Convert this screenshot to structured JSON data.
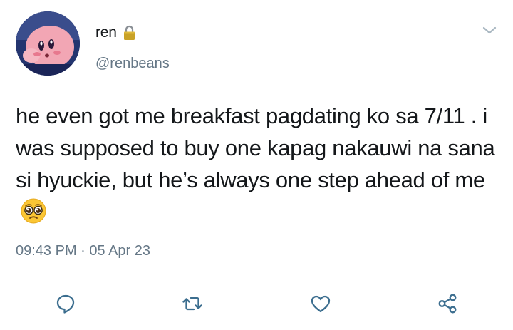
{
  "user": {
    "display_name": "ren",
    "handle": "@renbeans",
    "avatar_icon": "kirby-avatar",
    "protected_icon": "lock-icon"
  },
  "tweet": {
    "text": "he even got me breakfast pagdating ko sa 7/11 . i was supposed to buy one kapag nakauwi na sana si hyuckie, but he’s always one step ahead of me",
    "emoji": "pleading-face-emoji",
    "timestamp": "09:43 PM · 05 Apr 23"
  },
  "actions": [
    "reply-icon",
    "retweet-icon",
    "like-icon",
    "share-icon"
  ],
  "colors": {
    "text": "#14171a",
    "secondary": "#657786",
    "icon": "#3c6e8f",
    "divider": "#d8dde1"
  }
}
